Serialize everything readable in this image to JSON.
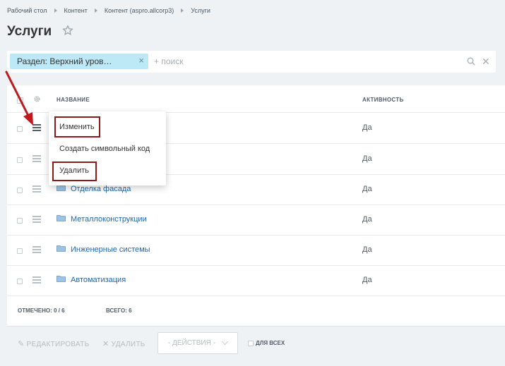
{
  "breadcrumb": [
    "Рабочий стол",
    "Контент",
    "Контент (aspro.allcorp3)",
    "Услуги"
  ],
  "page_title": "Услуги",
  "filter": {
    "chip_label": "Раздел: Верхний уров…",
    "chip_close": "×",
    "search_placeholder": "+ поиск",
    "clear_glyph": "✕"
  },
  "grid": {
    "columns": {
      "name": "НАЗВАНИЕ",
      "activity": "АКТИВНОСТЬ"
    },
    "rows": [
      {
        "name": "",
        "active": "Да",
        "folder": false
      },
      {
        "name": "",
        "active": "Да",
        "folder": false
      },
      {
        "name": "Отделка фасада",
        "active": "Да",
        "folder": true
      },
      {
        "name": "Металлоконструкции",
        "active": "Да",
        "folder": true
      },
      {
        "name": "Инженерные системы",
        "active": "Да",
        "folder": true
      },
      {
        "name": "Автоматизация",
        "active": "Да",
        "folder": true
      }
    ],
    "footer": {
      "selected": "ОТМЕЧЕНО: 0 / 6",
      "total": "ВСЕГО: 6"
    }
  },
  "context_menu": {
    "items": [
      "Изменить",
      "Создать символьный код",
      "Удалить"
    ]
  },
  "actions": {
    "edit": "РЕДАКТИРОВАТЬ",
    "delete": "УДАЛИТЬ",
    "select": "- ДЕЙСТВИЯ -",
    "for_all": "ДЛЯ ВСЕХ"
  },
  "colors": {
    "link": "#2067b0",
    "chip": "#bde8f6",
    "highlight": "#8b1a1a",
    "arrow": "#c0181d"
  },
  "icons": {
    "star": "star-icon",
    "gear": "gear-icon",
    "menu": "hamburger-icon",
    "folder": "folder-icon",
    "search": "search-icon",
    "pencil": "pencil-icon",
    "close": "close-icon",
    "chevron": "chevron-down-icon"
  }
}
